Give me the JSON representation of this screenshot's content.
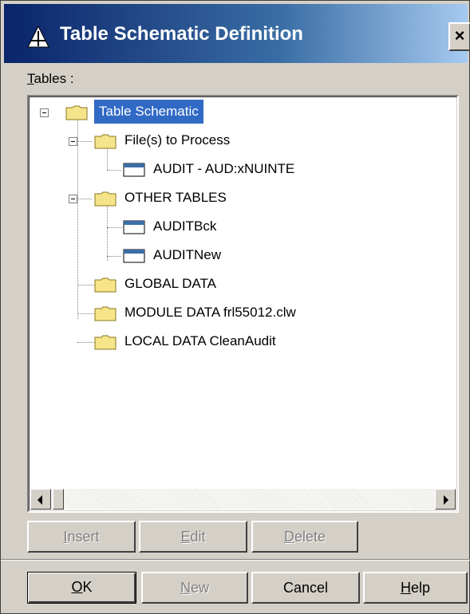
{
  "window": {
    "title": "Table Schematic Definition",
    "close_label": "×"
  },
  "tables_label": {
    "accel": "T",
    "rest": "ables :"
  },
  "tree": {
    "root": "Table Schematic",
    "files_group": "File(s) to Process",
    "file_item": "AUDIT - AUD:xNUINTE",
    "other_group": "OTHER TABLES",
    "other_items": [
      "AUDITBck",
      "AUDITNew"
    ],
    "global_data": "GLOBAL DATA",
    "module_data": "MODULE DATA frl55012.clw",
    "local_data": "LOCAL DATA CleanAudit"
  },
  "buttons": {
    "insert": {
      "accel": "I",
      "rest": "nsert"
    },
    "edit": {
      "accel": "E",
      "rest": "dit"
    },
    "delete": {
      "accel": "D",
      "rest": "elete"
    },
    "ok": {
      "accel": "O",
      "rest": "K"
    },
    "new": {
      "accel": "N",
      "rest": "ew"
    },
    "cancel": "Cancel",
    "help": {
      "accel": "H",
      "rest": "elp"
    }
  },
  "colors": {
    "selection": "#316ac5",
    "titlebar_start": "#0a246a",
    "titlebar_end": "#a6caf0",
    "face": "#d4d0c8"
  },
  "icons": [
    "app-icon",
    "folder-icon",
    "table-icon",
    "close-icon",
    "scroll-left-arrow-icon",
    "scroll-right-arrow-icon"
  ]
}
